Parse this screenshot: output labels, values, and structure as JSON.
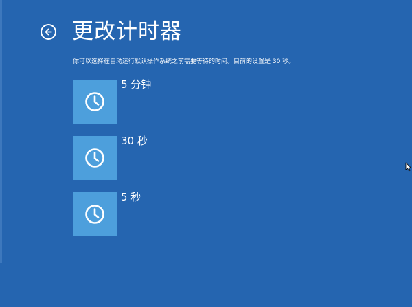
{
  "header": {
    "back_icon": "back-arrow-icon",
    "title": "更改计时器"
  },
  "description": "你可以选择在自动运行默认操作系统之前需要等待的时间。目前的设置是 30 秒。",
  "options": [
    {
      "label": "5 分钟",
      "icon": "clock-icon"
    },
    {
      "label": "30 秒",
      "icon": "clock-icon"
    },
    {
      "label": "5 秒",
      "icon": "clock-icon"
    }
  ],
  "colors": {
    "background": "#2565b0",
    "tile": "#4d9fdc",
    "text": "#ffffff"
  }
}
